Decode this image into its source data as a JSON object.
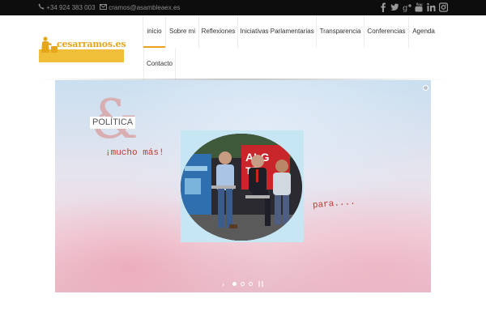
{
  "topbar": {
    "phone": "+34 924 383 003",
    "email": "cramos@asambleaex.es",
    "phone_icon": "phone-icon",
    "email_icon": "envelope-icon",
    "social": [
      "facebook-icon",
      "twitter-icon",
      "google-plus-icon",
      "youtube-icon",
      "linkedin-icon",
      "instagram-icon"
    ]
  },
  "logo": {
    "text": "cesarramos.es"
  },
  "nav": {
    "items": [
      {
        "label": "inicio",
        "active": true
      },
      {
        "label": "Sobre mi"
      },
      {
        "label": "Reflexiones"
      },
      {
        "label": "Iniciativas Parlamentarias"
      },
      {
        "label": "Transparencia"
      },
      {
        "label": "Conferencias"
      },
      {
        "label": "Agenda"
      },
      {
        "label": "Contacto"
      }
    ]
  },
  "slider": {
    "ampersand": "&",
    "word_politica": "POLÍTICA",
    "word_mucho": "¡mucho más!",
    "word_para": "para....",
    "slides_count": 3,
    "active_slide": 1
  },
  "colors": {
    "accent": "#e8a21b",
    "logo_bar": "#f0bf3a",
    "topbar": "#0d0d0d",
    "handwriting": "#c0392b"
  }
}
